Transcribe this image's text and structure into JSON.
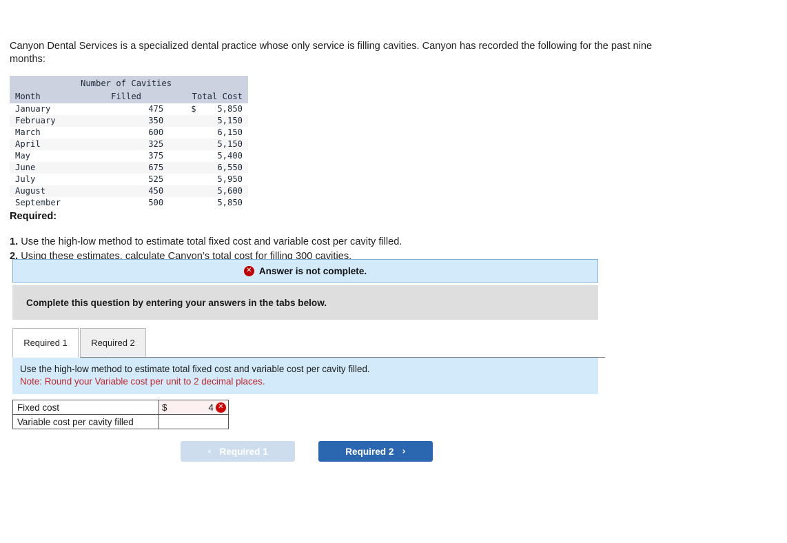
{
  "intro": "Canyon Dental Services is a specialized dental practice whose only service is filling cavities. Canyon has recorded the following for the past nine months:",
  "data_table": {
    "group_header": "Number of Cavities",
    "headers": [
      "Month",
      "Filled",
      "Total Cost"
    ],
    "rows": [
      {
        "month": "January",
        "filled": "475",
        "dollar": "$",
        "cost": "5,850"
      },
      {
        "month": "February",
        "filled": "350",
        "dollar": "",
        "cost": "5,150"
      },
      {
        "month": "March",
        "filled": "600",
        "dollar": "",
        "cost": "6,150"
      },
      {
        "month": "April",
        "filled": "325",
        "dollar": "",
        "cost": "5,150"
      },
      {
        "month": "May",
        "filled": "375",
        "dollar": "",
        "cost": "5,400"
      },
      {
        "month": "June",
        "filled": "675",
        "dollar": "",
        "cost": "6,550"
      },
      {
        "month": "July",
        "filled": "525",
        "dollar": "",
        "cost": "5,950"
      },
      {
        "month": "August",
        "filled": "450",
        "dollar": "",
        "cost": "5,600"
      },
      {
        "month": "September",
        "filled": "500",
        "dollar": "",
        "cost": "5,850"
      }
    ]
  },
  "required": {
    "heading": "Required:",
    "item1_num": "1.",
    "item1_text": "Use the high-low method to estimate total fixed cost and variable cost per cavity filled.",
    "item2_num": "2.",
    "item2_text": "Using these estimates, calculate Canyon’s total cost for filling 300 cavities."
  },
  "alert": {
    "icon": "error-x-icon",
    "icon_glyph": "✕",
    "text": "Answer is not complete.",
    "background_color": "#d3eafb",
    "border_color": "#7fb2d9",
    "icon_color": "#c00000"
  },
  "instruction_box": {
    "text": "Complete this question by entering your answers in the tabs below.",
    "background_color": "#dedede"
  },
  "tabs": [
    {
      "label": "Required 1",
      "active": true
    },
    {
      "label": "Required 2",
      "active": false
    }
  ],
  "panel": {
    "line1": "Use the high-low method to estimate total fixed cost and variable cost per cavity filled.",
    "line2": "Note: Round your Variable cost per unit to 2 decimal places.",
    "line2_color": "#c0262b",
    "background_color": "#d3eafb"
  },
  "answer_table": {
    "rows": [
      {
        "label": "Fixed cost",
        "dollar": "$",
        "value": "4",
        "has_error": true,
        "error_glyph": "✕",
        "cell_background": "#fdf0f0"
      },
      {
        "label": "Variable cost per cavity filled",
        "dollar": "",
        "value": "",
        "has_error": false,
        "error_glyph": "",
        "cell_background": "#ffffff"
      }
    ]
  },
  "nav": {
    "prev_label": "Required 1",
    "prev_chevron": "‹",
    "prev_disabled": true,
    "prev_color": "#cdddee",
    "next_label": "Required 2",
    "next_chevron": "›",
    "next_color": "#2b66b1"
  }
}
